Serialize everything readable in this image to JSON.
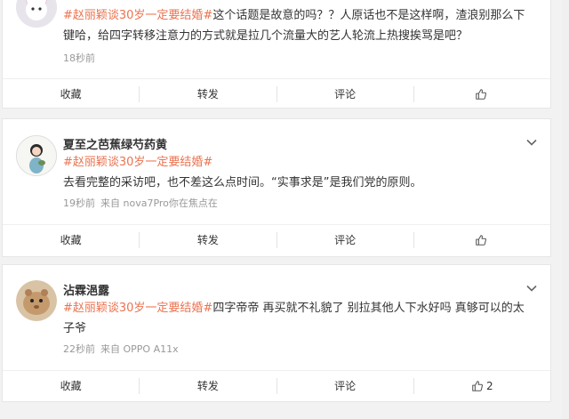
{
  "posts": [
    {
      "username": "",
      "topic": "#赵丽颖谈30岁一定要结婚#",
      "content": "这个话题是故意的吗？？人原话也不是这样啊，渣浪别那么下键哈，给四字转移注意力的方式就是拉几个流量大的艺人轮流上热搜挨骂是吧？",
      "time": "18秒前",
      "source": "",
      "actions": {
        "collect": "收藏",
        "repost": "转发",
        "comment": "评论",
        "like_count": ""
      }
    },
    {
      "username": "夏至之芭蕉绿芍药黄",
      "topic": "#赵丽颖谈30岁一定要结婚#",
      "content": "去看完整的采访吧，也不差这么点时间。“实事求是”是我们党的原则。",
      "time": "19秒前",
      "source": "来自 nova7Pro你在焦点在",
      "actions": {
        "collect": "收藏",
        "repost": "转发",
        "comment": "评论",
        "like_count": ""
      }
    },
    {
      "username": "沾霖浥露",
      "topic": "#赵丽颖谈30岁一定要结婚#",
      "content": "四字帝帝 再买就不礼貌了 别拉其他人下水好吗 真够可以的太子爷",
      "time": "22秒前",
      "source": "来自 OPPO A11x",
      "actions": {
        "collect": "收藏",
        "repost": "转发",
        "comment": "评论",
        "like_count": "2"
      }
    }
  ],
  "colors": {
    "topic": "#eb7350",
    "meta": "#999999",
    "background": "#f2f2f2"
  },
  "icons": {
    "like": "thumbs-up-icon",
    "menu": "chevron-down-icon"
  }
}
